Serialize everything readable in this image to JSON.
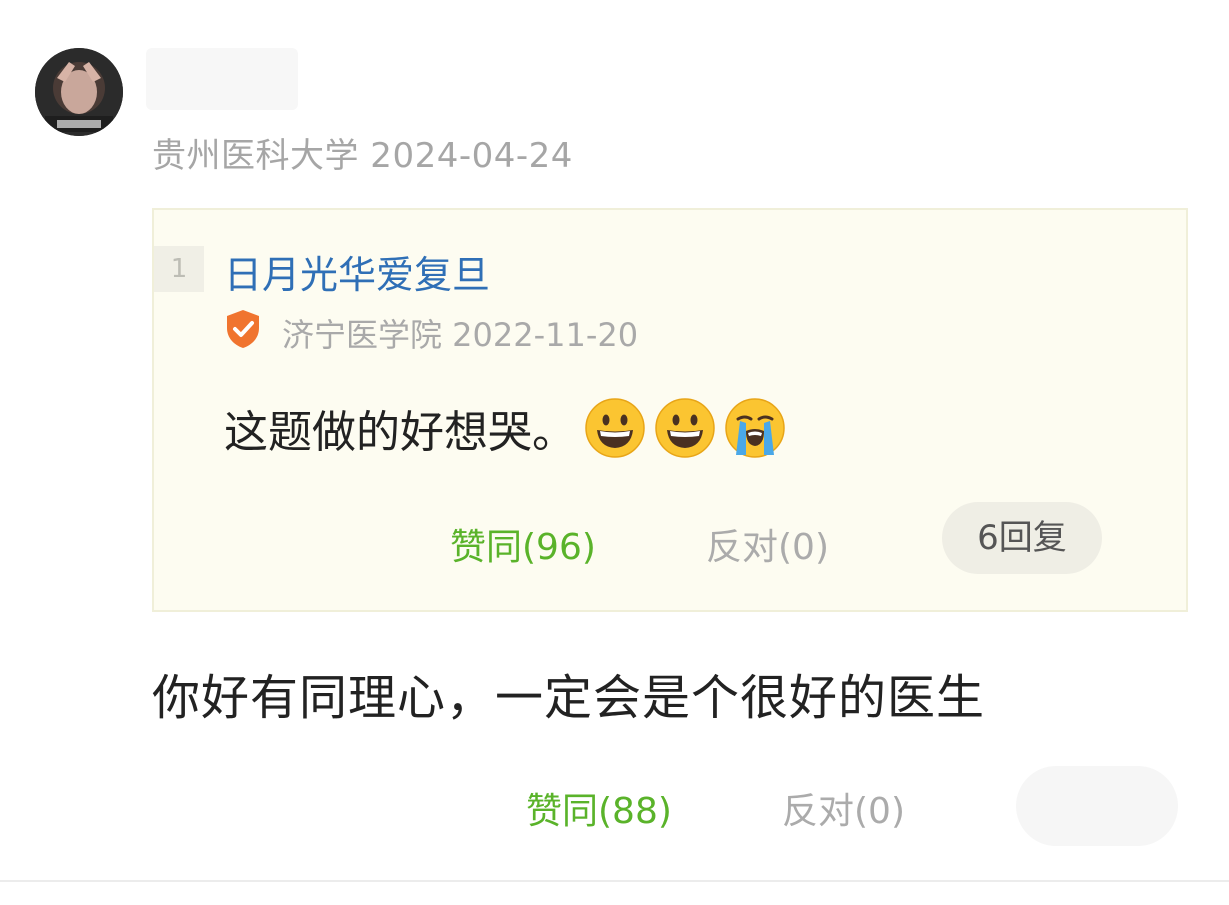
{
  "comment": {
    "author_meta": "贵州医科大学 2024-04-24",
    "text": "你好有同理心，一定会是个很好的医生",
    "agree": "赞同(88)",
    "oppose": "反对(0)"
  },
  "quoted": {
    "floor": "1",
    "username": "日月光华爱复旦",
    "meta": "济宁医学院 2022-11-20",
    "badge_icon": "shield-check-icon",
    "text": "这题做的好想哭。",
    "emojis": [
      "grinning-face-icon",
      "grinning-face-icon",
      "loudly-crying-face-icon"
    ],
    "agree": "赞同(96)",
    "oppose": "反对(0)",
    "replies": "6回复"
  },
  "colors": {
    "agree_green": "#5ab32a",
    "link_blue": "#2f6fb6",
    "muted_gray": "#a6a6a6",
    "quote_bg": "#fdfcf1"
  }
}
